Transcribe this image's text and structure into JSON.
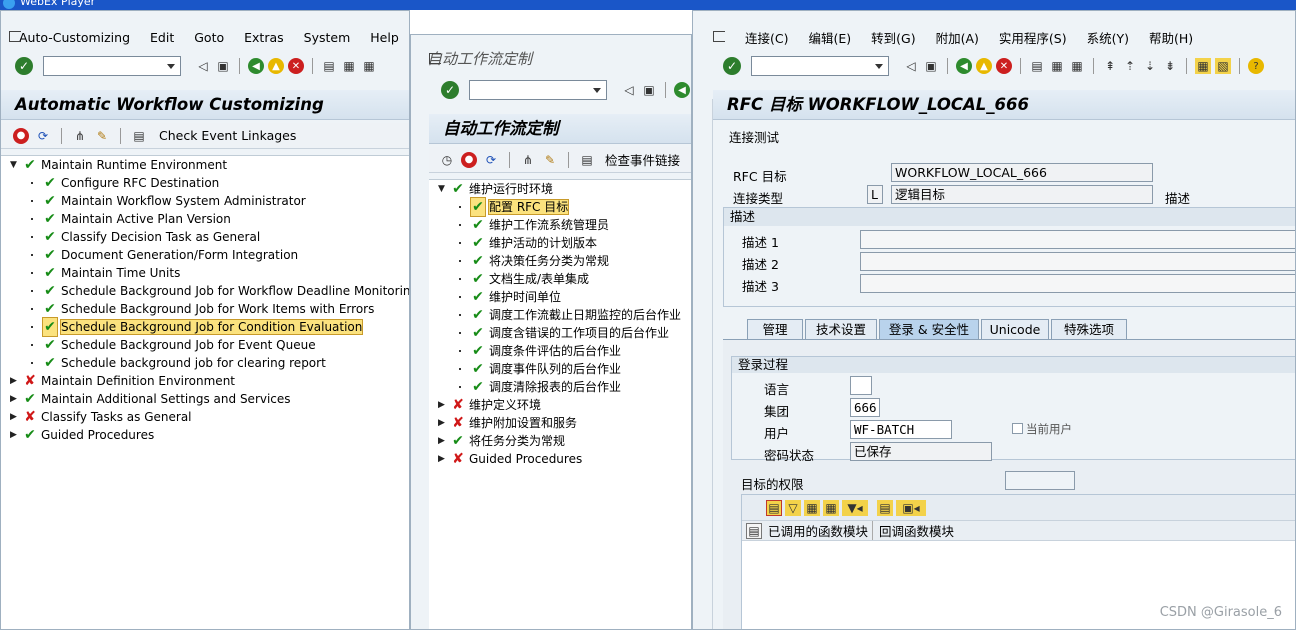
{
  "app_title": "WebEx Player",
  "watermark": "CSDN @Girasole_6",
  "win1": {
    "menu": [
      "Auto-Customizing",
      "Edit",
      "Goto",
      "Extras",
      "System",
      "Help"
    ],
    "header": "Automatic Workflow Customizing",
    "check_links": "Check Event Linkages",
    "tree": [
      {
        "label": "Maintain Runtime Environment",
        "status": "ok",
        "level": 0,
        "expanded": true
      },
      {
        "label": "Configure RFC Destination",
        "status": "ok",
        "level": 1
      },
      {
        "label": "Maintain Workflow System Administrator",
        "status": "ok",
        "level": 1
      },
      {
        "label": "Maintain Active Plan Version",
        "status": "ok",
        "level": 1
      },
      {
        "label": "Classify Decision Task as General",
        "status": "ok",
        "level": 1
      },
      {
        "label": "Document Generation/Form Integration",
        "status": "ok",
        "level": 1
      },
      {
        "label": "Maintain Time Units",
        "status": "ok",
        "level": 1
      },
      {
        "label": "Schedule Background Job for Workflow Deadline Monitoring",
        "status": "ok",
        "level": 1
      },
      {
        "label": "Schedule Background Job for Work Items with Errors",
        "status": "ok",
        "level": 1
      },
      {
        "label": "Schedule Background Job for Condition Evaluation",
        "status": "ok",
        "level": 1,
        "selected": true
      },
      {
        "label": "Schedule Background Job for Event Queue",
        "status": "ok",
        "level": 1
      },
      {
        "label": "Schedule background job for clearing report",
        "status": "ok",
        "level": 1
      },
      {
        "label": "Maintain Definition Environment",
        "status": "err",
        "level": 0
      },
      {
        "label": "Maintain Additional Settings and Services",
        "status": "ok",
        "level": 0
      },
      {
        "label": "Classify Tasks as General",
        "status": "err",
        "level": 0
      },
      {
        "label": "Guided Procedures",
        "status": "ok",
        "level": 0
      }
    ]
  },
  "win2": {
    "title": "自动工作流定制",
    "header": "自动工作流定制",
    "check_links": "检查事件链接",
    "tree": [
      {
        "label": "维护运行时环境",
        "status": "ok",
        "level": 0,
        "expanded": true
      },
      {
        "label": "配置 RFC 目标",
        "status": "ok",
        "level": 1,
        "selected": true
      },
      {
        "label": "维护工作流系统管理员",
        "status": "ok",
        "level": 1
      },
      {
        "label": "维护活动的计划版本",
        "status": "ok",
        "level": 1
      },
      {
        "label": "将决策任务分类为常规",
        "status": "ok",
        "level": 1
      },
      {
        "label": "文档生成/表单集成",
        "status": "ok",
        "level": 1
      },
      {
        "label": "维护时间单位",
        "status": "ok",
        "level": 1
      },
      {
        "label": "调度工作流截止日期监控的后台作业",
        "status": "ok",
        "level": 1
      },
      {
        "label": "调度含错误的工作项目的后台作业",
        "status": "ok",
        "level": 1
      },
      {
        "label": "调度条件评估的后台作业",
        "status": "ok",
        "level": 1
      },
      {
        "label": "调度事件队列的后台作业",
        "status": "ok",
        "level": 1
      },
      {
        "label": "调度清除报表的后台作业",
        "status": "ok",
        "level": 1
      },
      {
        "label": "维护定义环境",
        "status": "err",
        "level": 0
      },
      {
        "label": "维护附加设置和服务",
        "status": "err",
        "level": 0
      },
      {
        "label": "将任务分类为常规",
        "status": "ok",
        "level": 0
      },
      {
        "label": "Guided Procedures",
        "status": "err",
        "level": 0
      }
    ]
  },
  "win3": {
    "menu": [
      "连接(C)",
      "编辑(E)",
      "转到(G)",
      "附加(A)",
      "实用程序(S)",
      "系统(Y)",
      "帮助(H)"
    ],
    "header": "RFC 目标 WORKFLOW_LOCAL_666",
    "conn_test": "连接测试",
    "rfc_label": "RFC 目标",
    "rfc_value": "WORKFLOW_LOCAL_666",
    "conn_type_label": "连接类型",
    "conn_type_code": "L",
    "conn_type_text": "逻辑目标",
    "desc_label": "描述",
    "desc_group": "描述",
    "desc1": "描述 1",
    "desc2": "描述 2",
    "desc3": "描述 3",
    "tabs": [
      "管理",
      "技术设置",
      "登录 & 安全性",
      "Unicode",
      "特殊选项"
    ],
    "active_tab": 2,
    "login_group": "登录过程",
    "lang_label": "语言",
    "lang_value": "",
    "client_label": "集团",
    "client_value": "666",
    "user_label": "用户",
    "user_value": "WF-BATCH",
    "current_user": "当前用户",
    "pwd_label": "密码状态",
    "pwd_value": "已保存",
    "auth_label": "目标的权限",
    "fm_called": "已调用的函数模块",
    "fm_callback": "回调函数模块"
  }
}
